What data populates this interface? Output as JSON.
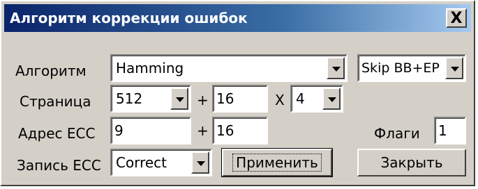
{
  "window": {
    "title": "Алгоритм коррекции ошибок",
    "close_icon": "close-icon",
    "close_glyph": "X"
  },
  "algorithm": {
    "label": "Алгоритм",
    "value": "Hamming",
    "mode_value": "Skip BB+EP"
  },
  "page": {
    "label": "Страница",
    "size_value": "512",
    "plus": "+",
    "spare_value": "16",
    "times": "X",
    "multiplier_value": "4"
  },
  "ecc_address": {
    "label": "Адрес ECC",
    "value": "9",
    "plus": "+",
    "offset_value": "16"
  },
  "flags": {
    "label": "Флаги",
    "value": "1"
  },
  "ecc_write": {
    "label": "Запись ECC",
    "value": "Correct"
  },
  "buttons": {
    "apply": "Применить",
    "close": "Закрыть"
  },
  "colors": {
    "face": "#d4d0c8",
    "title_start": "#0a246a",
    "title_end": "#a6caf0"
  }
}
